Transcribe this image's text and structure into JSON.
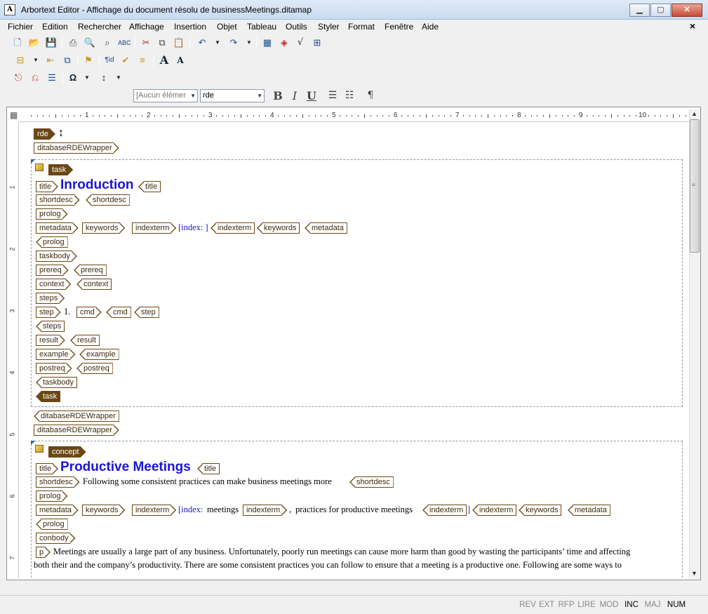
{
  "window": {
    "title": "Arbortext Editor - Affichage du document résolu de businessMeetings.ditamap",
    "app_icon": "A",
    "min": "▁",
    "max": "▢",
    "close": "✕"
  },
  "menu": [
    "Fichier",
    "Edition",
    "Rechercher",
    "Affichage",
    "Insertion",
    "Objet",
    "Tableau",
    "Outils",
    "Styler",
    "Format",
    "Fenêtre",
    "Aide"
  ],
  "doc_close": "×",
  "format_toolbar": {
    "element_combo": "[Aucun élémer",
    "style_combo": "rde",
    "bold": "B",
    "italic": "I",
    "underline": "U",
    "numbered_list": "☰",
    "bulleted_list": "☷",
    "pilcrow": "¶"
  },
  "ruler": {
    "numbers": [
      "1",
      "2",
      "3",
      "4",
      "5",
      "6",
      "7",
      "8",
      "9",
      "10"
    ],
    "vertical_numbers": [
      "1",
      "2",
      "3",
      "4",
      "5",
      "6",
      "7"
    ]
  },
  "document": {
    "root_tag": "rde",
    "wrapper_tag": "ditabaseRDEWrapper",
    "task": {
      "tag": "task",
      "title_tag": "title",
      "title": "Inroduction",
      "shortdesc_tag": "shortdesc",
      "prolog_tag": "prolog",
      "metadata_tag": "metadata",
      "keywords_tag": "keywords",
      "indexterm_tag": "indexterm",
      "index_text": "[index: ]",
      "taskbody_tag": "taskbody",
      "prereq_tag": "prereq",
      "context_tag": "context",
      "steps_tag": "steps",
      "step_tag": "step",
      "step_num": "1.",
      "cmd_tag": "cmd",
      "result_tag": "result",
      "example_tag": "example",
      "postreq_tag": "postreq"
    },
    "concept": {
      "tag": "concept",
      "title": "Productive Meetings",
      "shortdesc_text": "Following some consistent practices can make business meetings more",
      "index_prefix": "[index:",
      "index_term1": "meetings",
      "index_sep": ",",
      "index_term2": "practices for productive meetings",
      "index_close": "]",
      "conbody_tag": "conbody",
      "p_tag": "p",
      "para_line1": "Meetings are usually a large part of any business. Unfortunately, poorly run meetings can cause more harm than good by wasting the participants’ time and affecting",
      "para_line2": "both their and the company’s productivity. There are some consistent practices you can follow to ensure that a meeting is a productive one. Following are some ways to"
    }
  },
  "status": [
    {
      "label": "REV",
      "on": false
    },
    {
      "label": "EXT",
      "on": false
    },
    {
      "label": "RFP",
      "on": false
    },
    {
      "label": "LIRE",
      "on": false
    },
    {
      "label": "MOD",
      "on": false
    },
    {
      "label": "INC",
      "on": true
    },
    {
      "label": "MAJ",
      "on": false
    },
    {
      "label": "NUM",
      "on": true
    }
  ]
}
